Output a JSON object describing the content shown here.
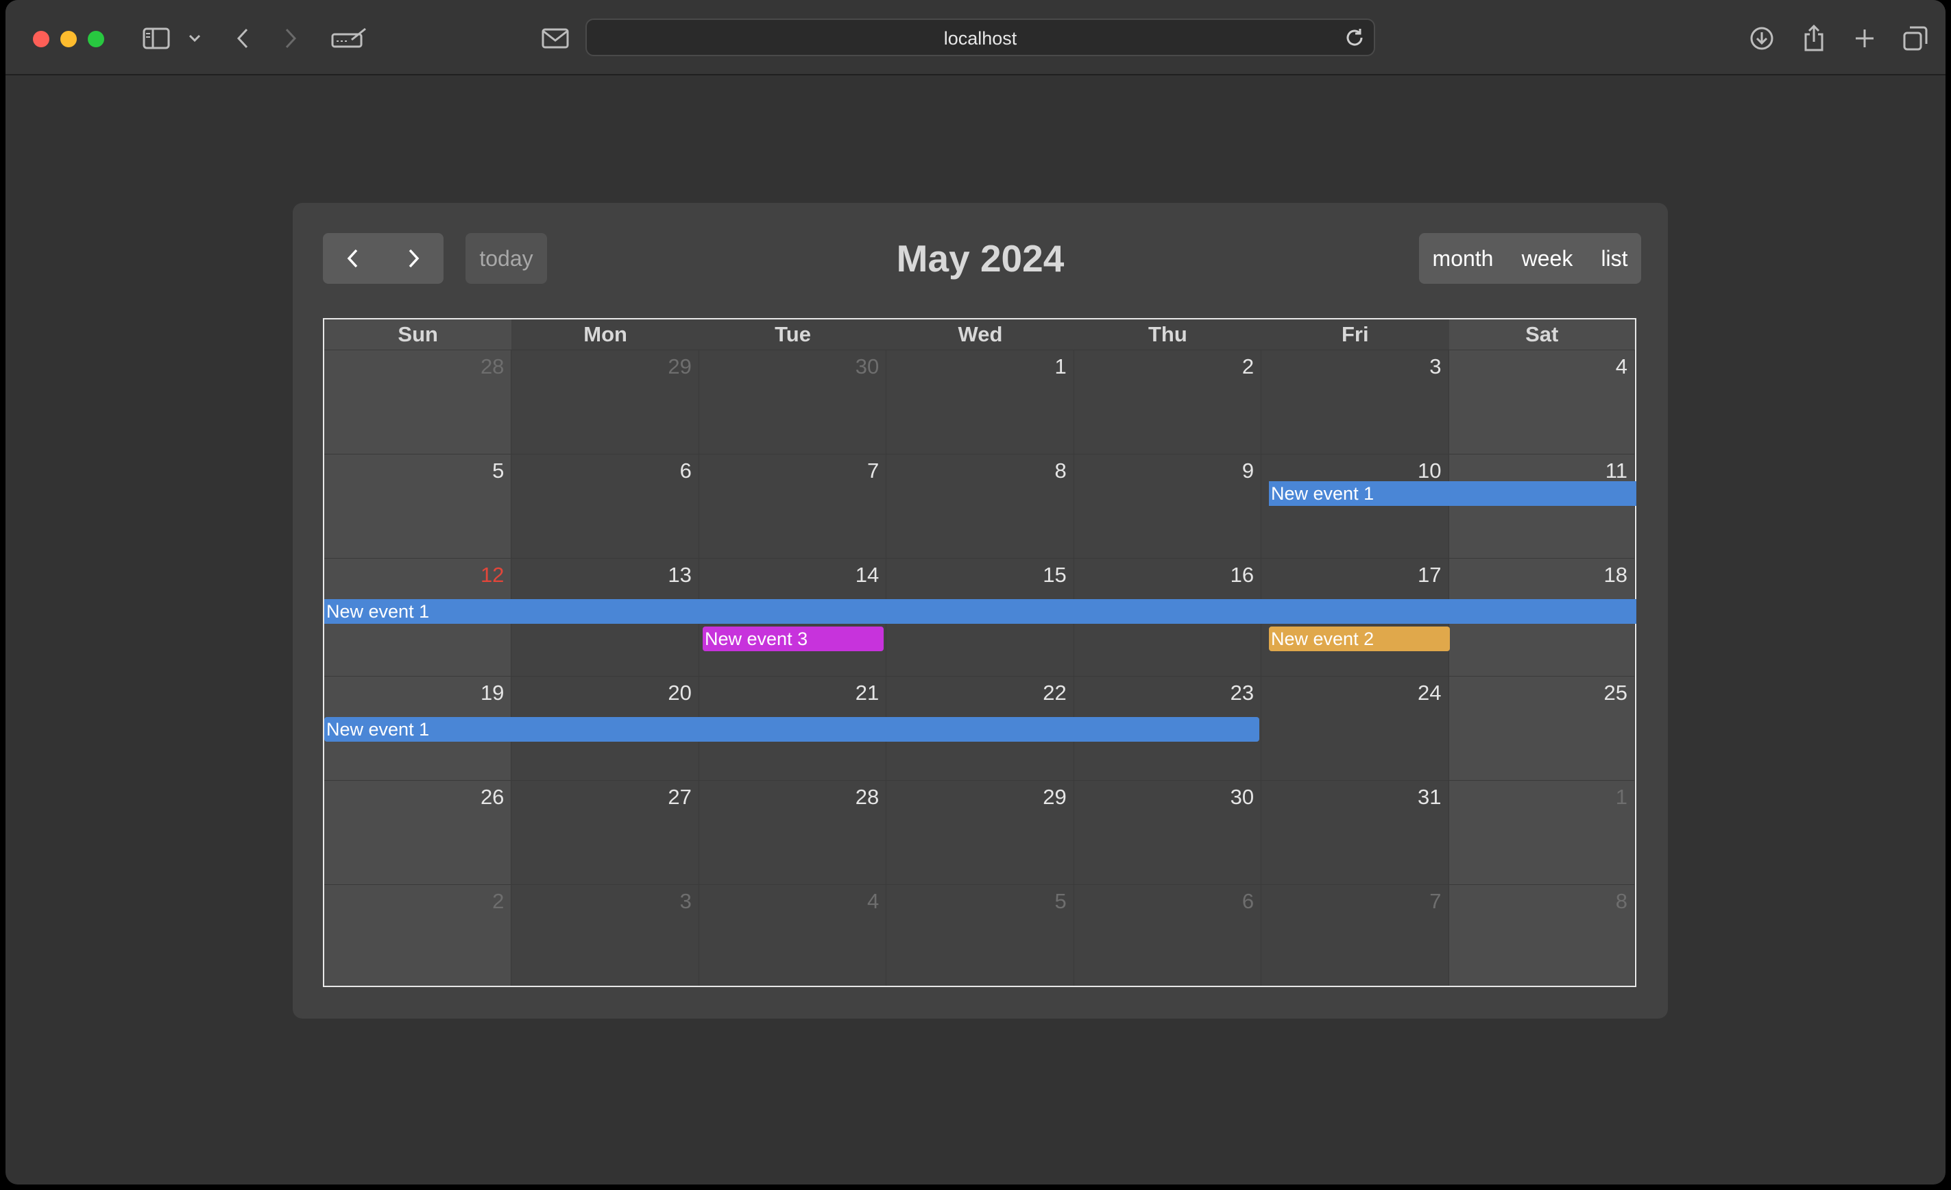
{
  "browser": {
    "url": "localhost",
    "icons": [
      "sidebar-icon",
      "chevron-down-icon",
      "back-icon",
      "forward-icon",
      "edit-icon",
      "mail-icon",
      "reload-icon",
      "download-icon",
      "share-icon",
      "plus-icon",
      "tabs-icon"
    ]
  },
  "calendar": {
    "title": "May 2024",
    "today_label": "today",
    "views": {
      "month": "month",
      "week": "week",
      "list": "list"
    },
    "days_of_week": [
      "Sun",
      "Mon",
      "Tue",
      "Wed",
      "Thu",
      "Fri",
      "Sat"
    ],
    "weeks": [
      [
        "28",
        "29",
        "30",
        "1",
        "2",
        "3",
        "4"
      ],
      [
        "5",
        "6",
        "7",
        "8",
        "9",
        "10",
        "11"
      ],
      [
        "12",
        "13",
        "14",
        "15",
        "16",
        "17",
        "18"
      ],
      [
        "19",
        "20",
        "21",
        "22",
        "23",
        "24",
        "25"
      ],
      [
        "26",
        "27",
        "28",
        "29",
        "30",
        "31",
        "1"
      ],
      [
        "2",
        "3",
        "4",
        "5",
        "6",
        "7",
        "8"
      ]
    ],
    "today_date": "12",
    "events": {
      "e1_week2": "New event 1",
      "e1_week3": "New event 1",
      "e3": "New event 3",
      "e2": "New event 2",
      "e1_week4": "New event 1"
    },
    "colors": {
      "event1": "#4a86d6",
      "event2": "#e0a84b",
      "event3": "#c733dc",
      "today": "#e2463a"
    }
  }
}
